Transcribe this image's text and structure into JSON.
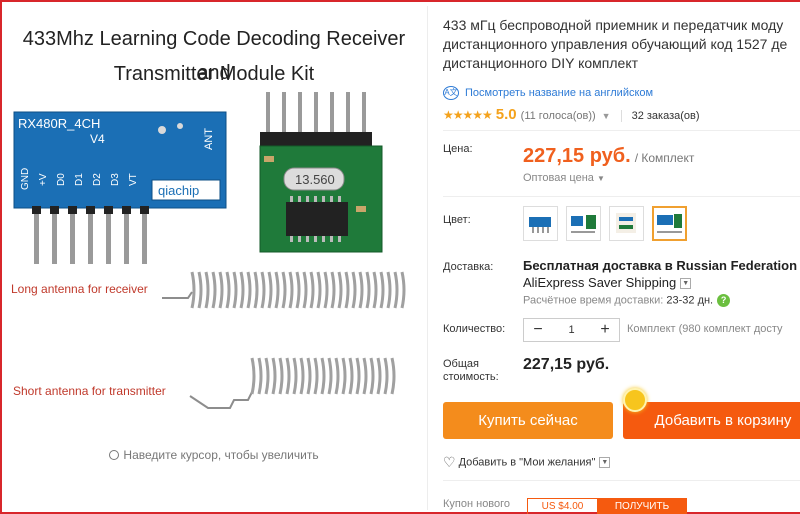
{
  "gallery": {
    "title_line1": "433Mhz Learning Code Decoding Receiver and",
    "title_line2": "Transmitter Module Kit",
    "board_model": "RX480R_4CH",
    "board_version": "V4",
    "board_ant": "ANT",
    "board_brand": "qiachip",
    "board_pins": [
      "GND",
      "+V",
      "D0",
      "D1",
      "D2",
      "D3",
      "VT"
    ],
    "crystal_label": "13.560",
    "long_antenna_label": "Long antenna for receiver",
    "short_antenna_label": "Short antenna for transmitter",
    "zoom_hint": "Наведите курсор, чтобы увеличить"
  },
  "product": {
    "title_line1": "433 мГц беспроводной приемник и передатчик моду",
    "title_line2": "дистанционного управления обучающий код 1527 де",
    "title_line3": "дистанционного DIY комплект",
    "translate_link": "Посмотреть название на английском",
    "rating_value": "5.0",
    "rating_votes": "(11 голоса(ов))",
    "orders": "32 заказа(ов)"
  },
  "price": {
    "label": "Цена:",
    "value": "227,15 руб.",
    "unit": "/ Комплект",
    "wholesale": "Оптовая цена"
  },
  "color": {
    "label": "Цвет:",
    "options_count": 4,
    "selected_index": 3
  },
  "shipping": {
    "label": "Доставка:",
    "main": "Бесплатная доставка в Russian Federation",
    "method": "AliExpress Saver Shipping",
    "time_label": "Расчётное время доставки:",
    "time_value": "23-32 дн."
  },
  "quantity": {
    "label": "Количество:",
    "value": "1",
    "minus": "−",
    "plus": "+",
    "note": "Комплект (980 комплект досту"
  },
  "total": {
    "label_line1": "Общая",
    "label_line2": "стоимость:",
    "value": "227,15 руб."
  },
  "actions": {
    "buy_now": "Купить сейчас",
    "add_to_cart": "Добавить в корзину",
    "wishlist": "Добавить в \"Мои желания\""
  },
  "coupon": {
    "label": "Купон нового",
    "amount": "US $4.00",
    "get": "ПОЛУЧИТЬ"
  },
  "colors": {
    "price": "#f0601e",
    "buy_button": "#f48c1c",
    "cart_button": "#f55a0f",
    "link": "#2e7bd6",
    "star": "#f4a21c",
    "frame": "#d8262b"
  }
}
